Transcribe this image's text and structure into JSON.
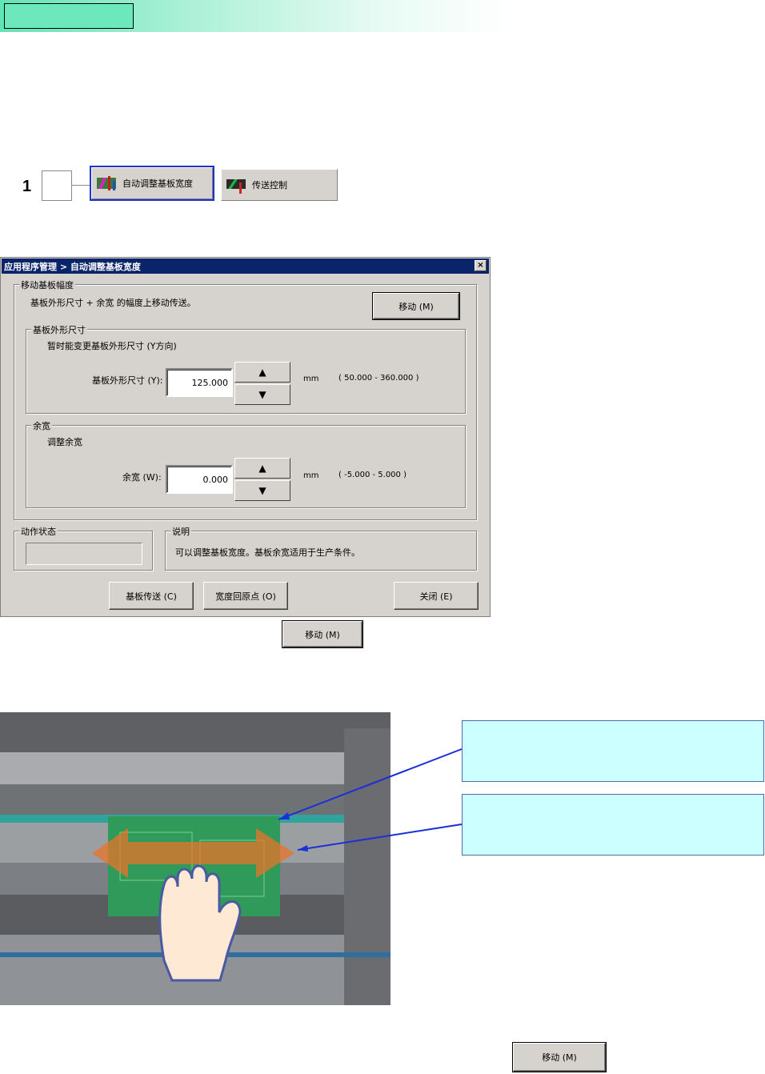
{
  "toolbar": {
    "step_number": "1",
    "auto_width_label": "自动调整基板宽度",
    "conveyor_label": "传送控制"
  },
  "dialog": {
    "title": "应用程序管理 > 自动调整基板宽度",
    "close_glyph": "×",
    "move_group": {
      "label": "移动基板幅度",
      "description": "基板外形尺寸 + 余宽 的幅度上移动传送。",
      "move_button": "移动 (M)"
    },
    "size_group": {
      "label": "基板外形尺寸",
      "note": "暂时能变更基板外形尺寸 (Y方向)",
      "field_label": "基板外形尺寸 (Y):",
      "value": "125.000",
      "unit": "mm",
      "range": "( 50.000 - 360.000 )"
    },
    "margin_group": {
      "label": "余宽",
      "note": "调整余宽",
      "field_label": "余宽 (W):",
      "value": "0.000",
      "unit": "mm",
      "range": "( -5.000 - 5.000 )"
    },
    "status_group": {
      "label": "动作状态"
    },
    "explain_group": {
      "label": "说明",
      "text": "可以调整基板宽度。基板余宽适用于生产条件。"
    },
    "buttons": {
      "conveyor": "基板传送 (C)",
      "home": "宽度回原点 (O)",
      "close": "关闭 (E)"
    }
  },
  "inline_buttons": {
    "move_mid": "移动 (M)",
    "move_bottom": "移动 (M)"
  },
  "spin_glyphs": {
    "up": "▲",
    "down": "▼"
  },
  "colors": {
    "banner": "#5fe6b7",
    "titlebar": "#0a246a",
    "callout": "#ccffff",
    "arrow": "#e8732a",
    "pcb": "#2f9a5a"
  }
}
